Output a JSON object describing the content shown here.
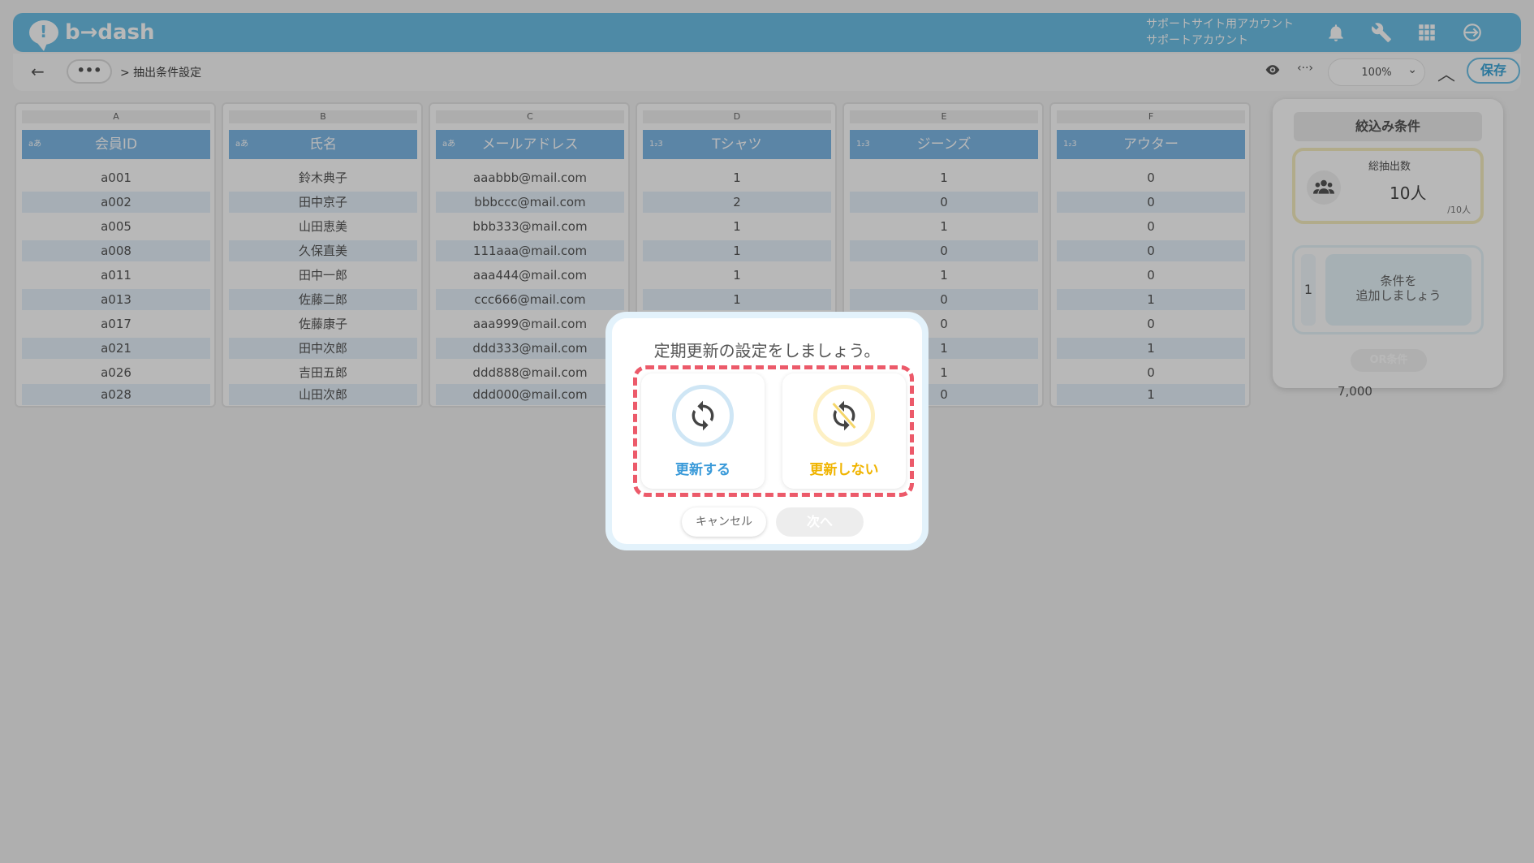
{
  "header": {
    "logo_text": "b→dash",
    "account_line1": "サポートサイト用アカウント",
    "account_line2": "サポートアカウント"
  },
  "toolbar": {
    "back": "←",
    "more": "•••",
    "breadcrumb": "> 抽出条件設定",
    "zoom": "100%",
    "save_label": "保存"
  },
  "grid": {
    "columns": [
      {
        "letter": "A",
        "type": "aあ",
        "name": "会員ID",
        "values": [
          "a001",
          "a002",
          "a005",
          "a008",
          "a011",
          "a013",
          "a017",
          "a021",
          "a026",
          "a028"
        ]
      },
      {
        "letter": "B",
        "type": "aあ",
        "name": "氏名",
        "values": [
          "鈴木典子",
          "田中京子",
          "山田恵美",
          "久保直美",
          "田中一郎",
          "佐藤二郎",
          "佐藤康子",
          "田中次郎",
          "吉田五郎",
          "山田次郎"
        ]
      },
      {
        "letter": "C",
        "type": "aあ",
        "name": "メールアドレス",
        "values": [
          "aaabbb@mail.com",
          "bbbccc@mail.com",
          "bbb333@mail.com",
          "111aaa@mail.com",
          "aaa444@mail.com",
          "ccc666@mail.com",
          "aaa999@mail.com",
          "ddd333@mail.com",
          "ddd888@mail.com",
          "ddd000@mail.com"
        ]
      },
      {
        "letter": "D",
        "type": "1₂3",
        "name": "Tシャツ",
        "values": [
          "1",
          "2",
          "1",
          "1",
          "1",
          "1",
          "",
          "",
          "",
          ""
        ]
      },
      {
        "letter": "E",
        "type": "1₂3",
        "name": "ジーンズ",
        "values": [
          "1",
          "0",
          "1",
          "0",
          "1",
          "0",
          "0",
          "1",
          "1",
          "0"
        ]
      },
      {
        "letter": "F",
        "type": "1₂3",
        "name": "アウター",
        "values": [
          "0",
          "0",
          "0",
          "0",
          "0",
          "1",
          "0",
          "1",
          "0",
          "1"
        ]
      }
    ],
    "partial_value": "7,000"
  },
  "filter_panel": {
    "title": "絞込み条件",
    "count_label": "総抽出数",
    "count_value": "10人",
    "count_total": "/10人",
    "condition_number": "1",
    "add_condition_line1": "条件を",
    "add_condition_line2": "追加しましょう",
    "or_label": "OR条件"
  },
  "modal": {
    "title": "定期更新の設定をしましょう。",
    "option_update": "更新する",
    "option_no_update": "更新しない",
    "cancel_label": "キャンセル",
    "next_label": "次へ"
  },
  "icons": [
    "bell-icon",
    "wrench-icon",
    "grid-icon",
    "logout-icon",
    "eye-icon",
    "code-icon",
    "users-icon",
    "refresh-icon",
    "no-refresh-icon"
  ],
  "colors": {
    "brand": "#6cc0e6",
    "column_header": "#7fb9e7",
    "highlight_dash": "#ec5a6a",
    "update_blue": "#3a9ad9",
    "no_update_yellow": "#f0b400"
  }
}
